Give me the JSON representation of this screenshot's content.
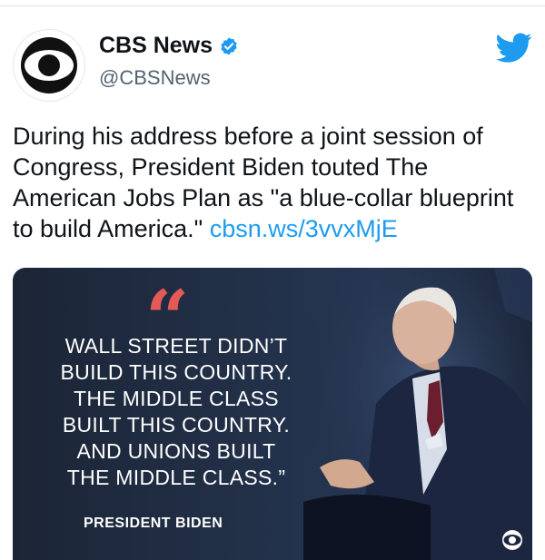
{
  "account": {
    "display_name": "CBS News",
    "handle": "@CBSNews",
    "verified_icon": "verified-badge-icon",
    "logo_icon": "cbs-eye-logo-icon"
  },
  "platform_icon": "twitter-bird-icon",
  "tweet": {
    "text": "During his address before a joint session of Congress, President Biden touted The American Jobs Plan as \"a blue-collar blueprint to build America.\"",
    "link": "cbsn.ws/3vvxMjE"
  },
  "media": {
    "quote_mark": "“",
    "quote_lines": [
      "WALL STREET DIDN’T",
      "BUILD THIS COUNTRY.",
      "THE MIDDLE CLASS",
      "BUILT THIS COUNTRY.",
      "AND UNIONS BUILT",
      "THE MIDDLE CLASS.”"
    ],
    "attribution": "PRESIDENT BIDEN",
    "watermark_icon": "cbs-eye-watermark-icon"
  },
  "colors": {
    "link": "#1d9bf0",
    "twitter_blue": "#1d9bf0",
    "quote_mark": "#e45a57",
    "media_bg": "#223048"
  }
}
